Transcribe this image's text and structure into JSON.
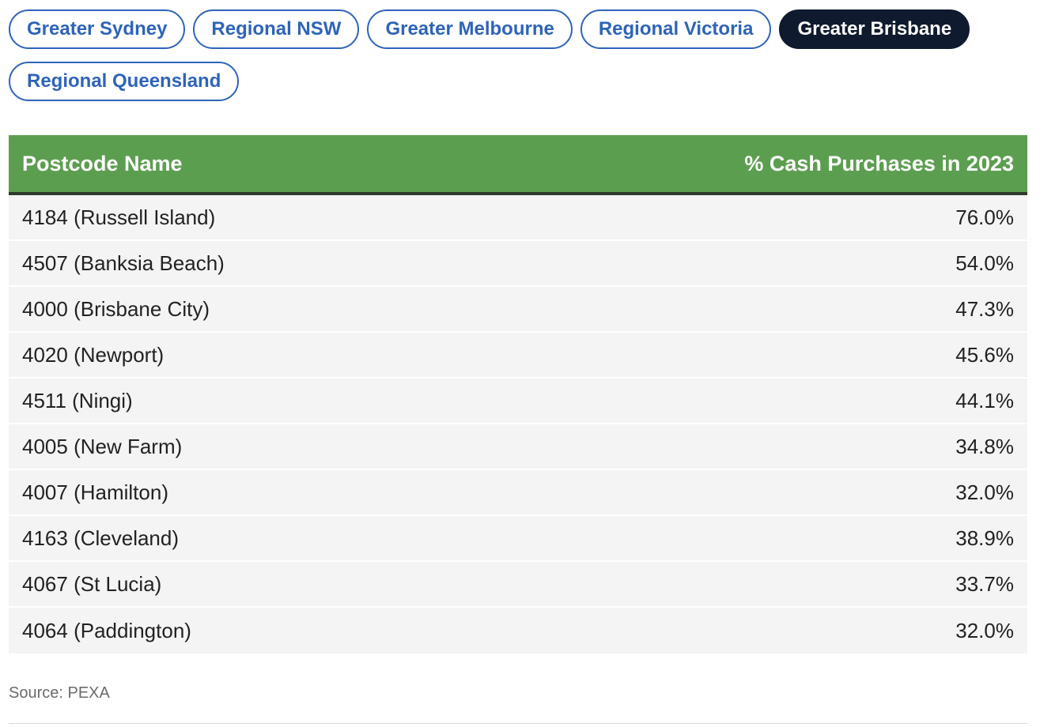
{
  "tabs": {
    "row1": [
      {
        "label": "Greater Sydney",
        "active": false
      },
      {
        "label": "Regional NSW",
        "active": false
      },
      {
        "label": "Greater Melbourne",
        "active": false
      },
      {
        "label": "Regional Victoria",
        "active": false
      },
      {
        "label": "Greater Brisbane",
        "active": true
      }
    ],
    "row2": [
      {
        "label": "Regional Queensland",
        "active": false
      }
    ]
  },
  "table": {
    "headers": [
      "Postcode Name",
      "% Cash Purchases in 2023"
    ],
    "rows": [
      [
        "4184 (Russell Island)",
        "76.0%"
      ],
      [
        "4507 (Banksia Beach)",
        "54.0%"
      ],
      [
        "4000 (Brisbane City)",
        "47.3%"
      ],
      [
        "4020 (Newport)",
        "45.6%"
      ],
      [
        "4511 (Ningi)",
        "44.1%"
      ],
      [
        "4005 (New Farm)",
        "34.8%"
      ],
      [
        "4007 (Hamilton)",
        "32.0%"
      ],
      [
        "4163 (Cleveland)",
        "38.9%"
      ],
      [
        "4067 (St Lucia)",
        "33.7%"
      ],
      [
        "4064 (Paddington)",
        "32.0%"
      ]
    ]
  },
  "source": "Source: PEXA",
  "colors": {
    "tab_accent": "#2e64b8",
    "tab_active_bg": "#0f1a2e",
    "header_bg": "#5c9e50",
    "row_bg": "#f4f4f4"
  }
}
